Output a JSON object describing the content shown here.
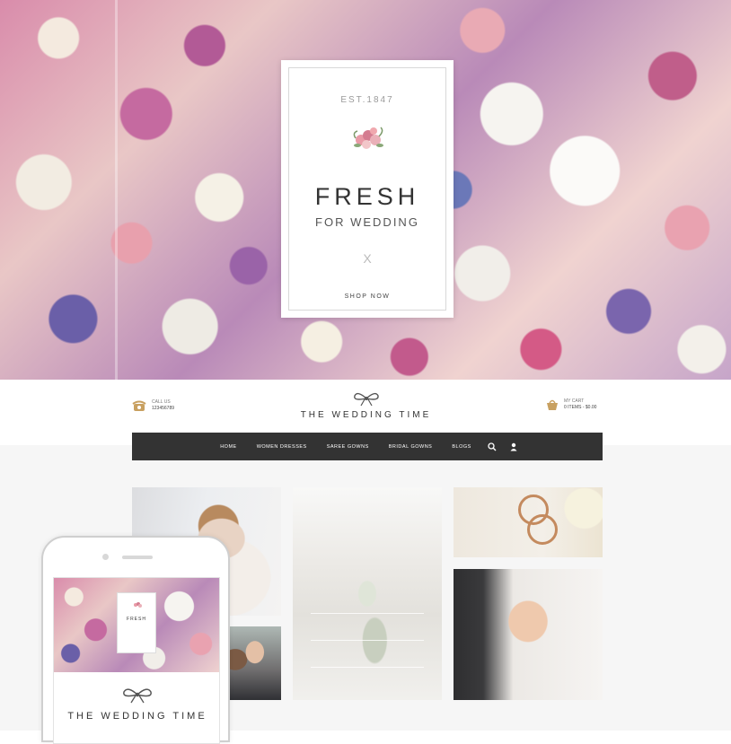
{
  "hero": {
    "est": "EST.1847",
    "title": "FRESH",
    "subtitle": "FOR WEDDING",
    "close": "X",
    "cta": "SHOP NOW"
  },
  "header": {
    "call_label": "CALL US",
    "call_number": "123456789",
    "logo_text": "THE WEDDING TIME",
    "cart_label": "MY CART",
    "cart_summary": "0 ITEMS - $0.00"
  },
  "nav": {
    "items": [
      "HOME",
      "WOMEN DRESSES",
      "SAREE GOWNS",
      "BRIDAL GOWNS",
      "BLOGS"
    ],
    "icons": [
      "search-icon",
      "user-icon"
    ]
  },
  "phone": {
    "logo_text": "THE WEDDING TIME"
  },
  "colors": {
    "navbar": "#333333",
    "accent": "#c8a060",
    "page_bg": "#f6f6f6"
  }
}
